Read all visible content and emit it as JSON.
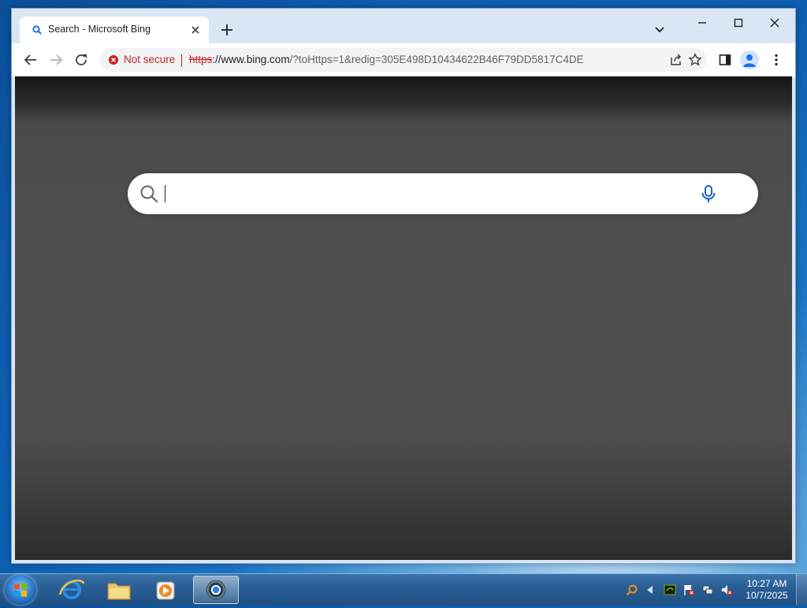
{
  "browser": {
    "tab": {
      "title": "Search - Microsoft Bing"
    },
    "address": {
      "security_label": "Not secure",
      "url_scheme": "https",
      "url_host": "://www.bing.com",
      "url_rest": "/?toHttps=1&redig=305E498D10434622B46F79DD5817C4DE"
    }
  },
  "search": {
    "value": "",
    "placeholder": ""
  },
  "taskbar": {
    "clock_time": "10:27 AM",
    "clock_date": "10/7/2025"
  },
  "colors": {
    "insecure": "#c5221f",
    "bing_blue": "#1a73e8"
  }
}
